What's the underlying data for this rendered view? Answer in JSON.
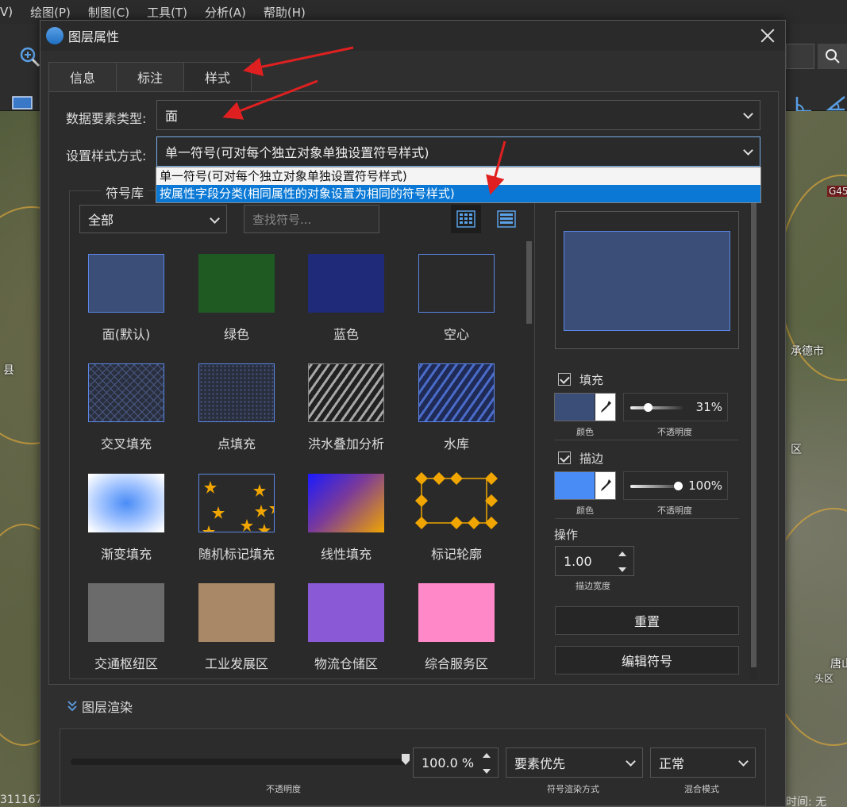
{
  "menubar": {
    "items": [
      "V)",
      "绘图(P)",
      "制图(C)",
      "工具(T)",
      "分析(A)",
      "帮助(H)"
    ]
  },
  "map": {
    "labels": [
      "承德市",
      "G45",
      "唐山",
      "县",
      "区",
      "头区"
    ],
    "status_left": "311167",
    "status_right": "时间: 无"
  },
  "dialog": {
    "title": "图层属性",
    "tabs": [
      {
        "label": "信息",
        "active": false
      },
      {
        "label": "标注",
        "active": false
      },
      {
        "label": "样式",
        "active": true
      }
    ],
    "feature_type": {
      "label": "数据要素类型:",
      "value": "面"
    },
    "style_mode": {
      "label": "设置样式方式:",
      "value": "单一符号(可对每个独立对象单独设置符号样式)",
      "options": [
        {
          "text": "单一符号(可对每个独立对象单独设置符号样式)",
          "selected": false
        },
        {
          "text": "按属性字段分类(相同属性的对象设置为相同的符号样式)",
          "selected": true
        }
      ]
    },
    "symbol_library": {
      "title": "符号库",
      "category": "全部",
      "search_placeholder": "查找符号...",
      "symbols": [
        {
          "label": "面(默认)",
          "kind": "solid",
          "color": "#3a4e77"
        },
        {
          "label": "绿色",
          "kind": "solid",
          "color": "#1f5a22"
        },
        {
          "label": "蓝色",
          "kind": "solid",
          "color": "#1f2a78"
        },
        {
          "label": "空心",
          "kind": "hollow",
          "color": "#5b86e6"
        },
        {
          "label": "交叉填充",
          "kind": "cross",
          "color": "#5b86e6"
        },
        {
          "label": "点填充",
          "kind": "dots",
          "color": "#5b86e6"
        },
        {
          "label": "洪水叠加分析",
          "kind": "stripes-gray",
          "color": "#aaaaaa"
        },
        {
          "label": "水库",
          "kind": "stripes-blue",
          "color": "#5b86e6"
        },
        {
          "label": "渐变填充",
          "kind": "radial",
          "color": "#4a8cf5"
        },
        {
          "label": "随机标记填充",
          "kind": "stars",
          "color": "#f0a500"
        },
        {
          "label": "线性填充",
          "kind": "linear",
          "color": "#f0a500"
        },
        {
          "label": "标记轮廓",
          "kind": "marker-outline",
          "color": "#f0a500"
        },
        {
          "label": "交通枢纽区",
          "kind": "solid",
          "color": "#6b6b6b"
        },
        {
          "label": "工业发展区",
          "kind": "solid",
          "color": "#a88866"
        },
        {
          "label": "物流仓储区",
          "kind": "solid",
          "color": "#8a5ad6"
        },
        {
          "label": "综合服务区",
          "kind": "solid",
          "color": "#ff88c8"
        }
      ]
    },
    "style_panel": {
      "fill": {
        "label": "填充",
        "checked": true,
        "color": "#3a4e77",
        "color_label": "颜色",
        "opacity": "31%",
        "opacity_label": "不透明度",
        "opacity_fraction": 0.31
      },
      "stroke": {
        "label": "描边",
        "checked": true,
        "color": "#4a8cf5",
        "color_label": "颜色",
        "opacity": "100%",
        "opacity_label": "不透明度",
        "opacity_fraction": 1.0
      },
      "operation": {
        "label": "操作",
        "width": "1.00",
        "width_label": "描边宽度"
      },
      "reset_label": "重置",
      "edit_label": "编辑符号"
    },
    "rendering": {
      "title": "图层渲染",
      "opacity_value": "100.0 %",
      "opacity_label": "不透明度",
      "render_mode": "要素优先",
      "render_mode_label": "符号渲染方式",
      "blend_mode": "正常",
      "blend_mode_label": "混合模式"
    }
  },
  "colors": {
    "accent": "#0a78d4",
    "annotation_arrow": "#e02020"
  }
}
